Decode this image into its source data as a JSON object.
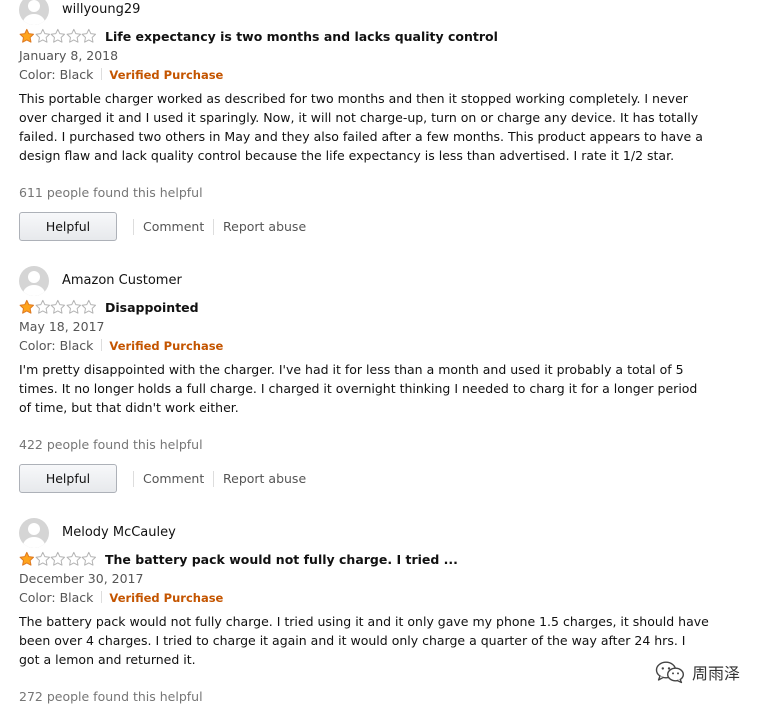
{
  "reviews": [
    {
      "author": "willyoung29",
      "rating": 1,
      "rating_max": 5,
      "title": "Life expectancy is two months and lacks quality control",
      "date": "January 8, 2018",
      "color_label": "Color: Black",
      "verified": "Verified Purchase",
      "body": "This portable charger worked as described for two months and then it stopped working completely. I never over charged it and I used it sparingly. Now, it will not charge-up, turn on or charge any device. It has totally failed. I purchased two others in May and they also failed after a few months. This product appears to have a design flaw and lack quality control because the life expectancy is less than advertised. I rate it 1/2 star.",
      "helpful_count": "611 people found this helpful",
      "helpful_button": "Helpful",
      "comment_link": "Comment",
      "report_link": "Report abuse"
    },
    {
      "author": "Amazon Customer",
      "rating": 1,
      "rating_max": 5,
      "title": "Disappointed",
      "date": "May 18, 2017",
      "color_label": "Color: Black",
      "verified": "Verified Purchase",
      "body": "I'm pretty disappointed with the charger. I've had it for less than a month and used it probably a total of 5 times. It no longer holds a full charge. I charged it overnight thinking I needed to charg it for a longer period of time, but that didn't work either.",
      "helpful_count": "422 people found this helpful",
      "helpful_button": "Helpful",
      "comment_link": "Comment",
      "report_link": "Report abuse"
    },
    {
      "author": "Melody McCauley",
      "rating": 1,
      "rating_max": 5,
      "title": "The battery pack would not fully charge. I tried ...",
      "date": "December 30, 2017",
      "color_label": "Color: Black",
      "verified": "Verified Purchase",
      "body": "The battery pack would not fully charge. I tried using it and it only gave my phone 1.5 charges, it should have been over 4 charges. I tried to charge it again and it would only charge a quarter of the way after 24 hrs. I got a lemon and returned it.",
      "helpful_count": "272 people found this helpful"
    }
  ],
  "watermark": {
    "icon": "wechat-icon",
    "text": "周雨泽"
  },
  "colors": {
    "star_fill": "#ffa41c",
    "star_stroke": "#de7921",
    "empty_star_stroke": "#b3b3b3",
    "verified": "#c45500",
    "muted": "#767676"
  }
}
